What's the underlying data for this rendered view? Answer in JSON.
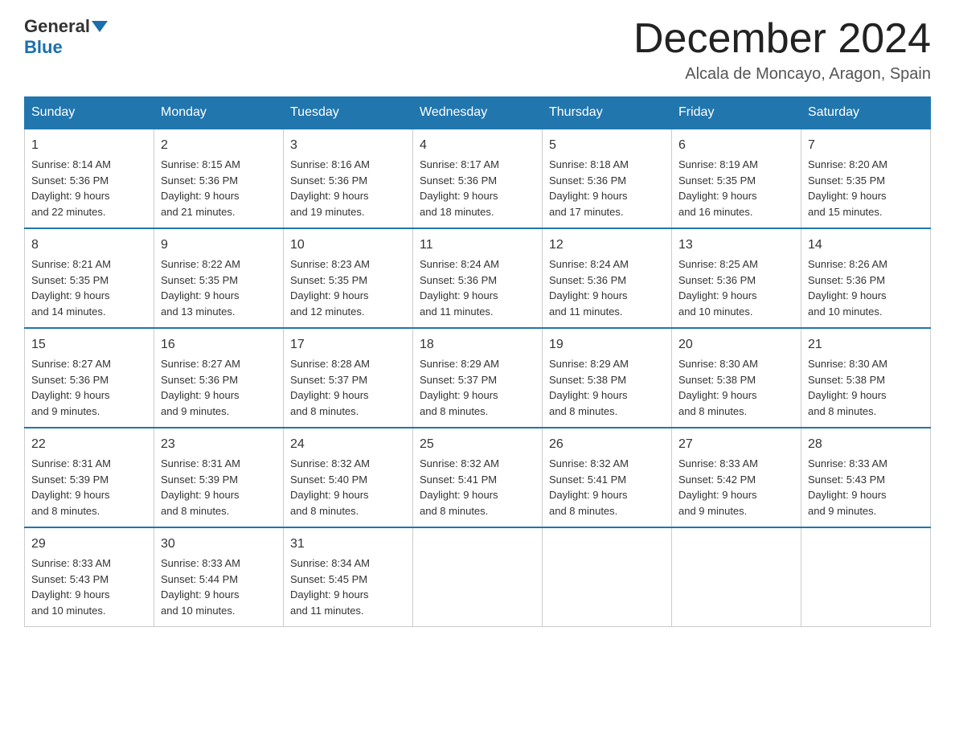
{
  "header": {
    "logo_general": "General",
    "logo_blue": "Blue",
    "month_title": "December 2024",
    "location": "Alcala de Moncayo, Aragon, Spain"
  },
  "days_of_week": [
    "Sunday",
    "Monday",
    "Tuesday",
    "Wednesday",
    "Thursday",
    "Friday",
    "Saturday"
  ],
  "weeks": [
    [
      {
        "day": "1",
        "sunrise": "8:14 AM",
        "sunset": "5:36 PM",
        "daylight": "9 hours and 22 minutes."
      },
      {
        "day": "2",
        "sunrise": "8:15 AM",
        "sunset": "5:36 PM",
        "daylight": "9 hours and 21 minutes."
      },
      {
        "day": "3",
        "sunrise": "8:16 AM",
        "sunset": "5:36 PM",
        "daylight": "9 hours and 19 minutes."
      },
      {
        "day": "4",
        "sunrise": "8:17 AM",
        "sunset": "5:36 PM",
        "daylight": "9 hours and 18 minutes."
      },
      {
        "day": "5",
        "sunrise": "8:18 AM",
        "sunset": "5:36 PM",
        "daylight": "9 hours and 17 minutes."
      },
      {
        "day": "6",
        "sunrise": "8:19 AM",
        "sunset": "5:35 PM",
        "daylight": "9 hours and 16 minutes."
      },
      {
        "day": "7",
        "sunrise": "8:20 AM",
        "sunset": "5:35 PM",
        "daylight": "9 hours and 15 minutes."
      }
    ],
    [
      {
        "day": "8",
        "sunrise": "8:21 AM",
        "sunset": "5:35 PM",
        "daylight": "9 hours and 14 minutes."
      },
      {
        "day": "9",
        "sunrise": "8:22 AM",
        "sunset": "5:35 PM",
        "daylight": "9 hours and 13 minutes."
      },
      {
        "day": "10",
        "sunrise": "8:23 AM",
        "sunset": "5:35 PM",
        "daylight": "9 hours and 12 minutes."
      },
      {
        "day": "11",
        "sunrise": "8:24 AM",
        "sunset": "5:36 PM",
        "daylight": "9 hours and 11 minutes."
      },
      {
        "day": "12",
        "sunrise": "8:24 AM",
        "sunset": "5:36 PM",
        "daylight": "9 hours and 11 minutes."
      },
      {
        "day": "13",
        "sunrise": "8:25 AM",
        "sunset": "5:36 PM",
        "daylight": "9 hours and 10 minutes."
      },
      {
        "day": "14",
        "sunrise": "8:26 AM",
        "sunset": "5:36 PM",
        "daylight": "9 hours and 10 minutes."
      }
    ],
    [
      {
        "day": "15",
        "sunrise": "8:27 AM",
        "sunset": "5:36 PM",
        "daylight": "9 hours and 9 minutes."
      },
      {
        "day": "16",
        "sunrise": "8:27 AM",
        "sunset": "5:36 PM",
        "daylight": "9 hours and 9 minutes."
      },
      {
        "day": "17",
        "sunrise": "8:28 AM",
        "sunset": "5:37 PM",
        "daylight": "9 hours and 8 minutes."
      },
      {
        "day": "18",
        "sunrise": "8:29 AM",
        "sunset": "5:37 PM",
        "daylight": "9 hours and 8 minutes."
      },
      {
        "day": "19",
        "sunrise": "8:29 AM",
        "sunset": "5:38 PM",
        "daylight": "9 hours and 8 minutes."
      },
      {
        "day": "20",
        "sunrise": "8:30 AM",
        "sunset": "5:38 PM",
        "daylight": "9 hours and 8 minutes."
      },
      {
        "day": "21",
        "sunrise": "8:30 AM",
        "sunset": "5:38 PM",
        "daylight": "9 hours and 8 minutes."
      }
    ],
    [
      {
        "day": "22",
        "sunrise": "8:31 AM",
        "sunset": "5:39 PM",
        "daylight": "9 hours and 8 minutes."
      },
      {
        "day": "23",
        "sunrise": "8:31 AM",
        "sunset": "5:39 PM",
        "daylight": "9 hours and 8 minutes."
      },
      {
        "day": "24",
        "sunrise": "8:32 AM",
        "sunset": "5:40 PM",
        "daylight": "9 hours and 8 minutes."
      },
      {
        "day": "25",
        "sunrise": "8:32 AM",
        "sunset": "5:41 PM",
        "daylight": "9 hours and 8 minutes."
      },
      {
        "day": "26",
        "sunrise": "8:32 AM",
        "sunset": "5:41 PM",
        "daylight": "9 hours and 8 minutes."
      },
      {
        "day": "27",
        "sunrise": "8:33 AM",
        "sunset": "5:42 PM",
        "daylight": "9 hours and 9 minutes."
      },
      {
        "day": "28",
        "sunrise": "8:33 AM",
        "sunset": "5:43 PM",
        "daylight": "9 hours and 9 minutes."
      }
    ],
    [
      {
        "day": "29",
        "sunrise": "8:33 AM",
        "sunset": "5:43 PM",
        "daylight": "9 hours and 10 minutes."
      },
      {
        "day": "30",
        "sunrise": "8:33 AM",
        "sunset": "5:44 PM",
        "daylight": "9 hours and 10 minutes."
      },
      {
        "day": "31",
        "sunrise": "8:34 AM",
        "sunset": "5:45 PM",
        "daylight": "9 hours and 11 minutes."
      },
      null,
      null,
      null,
      null
    ]
  ],
  "labels": {
    "sunrise": "Sunrise:",
    "sunset": "Sunset:",
    "daylight": "Daylight:"
  }
}
